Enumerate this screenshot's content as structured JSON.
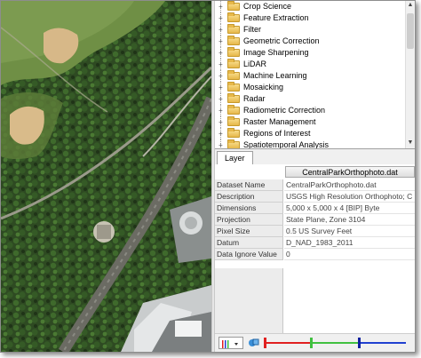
{
  "toolbox": {
    "items": [
      {
        "label": "Crop Science"
      },
      {
        "label": "Feature Extraction"
      },
      {
        "label": "Filter"
      },
      {
        "label": "Geometric Correction"
      },
      {
        "label": "Image Sharpening"
      },
      {
        "label": "LiDAR"
      },
      {
        "label": "Machine Learning"
      },
      {
        "label": "Mosaicking"
      },
      {
        "label": "Radar"
      },
      {
        "label": "Radiometric Correction"
      },
      {
        "label": "Raster Management"
      },
      {
        "label": "Regions of Interest"
      },
      {
        "label": "Spatiotemporal Analysis"
      }
    ],
    "expander": "+"
  },
  "layer_panel": {
    "tab_label": "Layer",
    "file_name": "CentralParkOrthophoto.dat",
    "properties": [
      {
        "key": "Dataset Name",
        "value": "CentralParkOrthophoto.dat"
      },
      {
        "key": "Description",
        "value": "USGS High Resolution Orthophoto; C"
      },
      {
        "key": "Dimensions",
        "value": "5,000 x 5,000 x 4 [BIP] Byte"
      },
      {
        "key": "Projection",
        "value": "State Plane, Zone 3104"
      },
      {
        "key": "Pixel Size",
        "value": "0.5 US Survey Feet"
      },
      {
        "key": "Datum",
        "value": "D_NAD_1983_2011"
      },
      {
        "key": "Data Ignore Value",
        "value": "0"
      }
    ]
  },
  "colors": {
    "stretch_red": "#e02020",
    "stretch_green": "#40c040",
    "stretch_blue": "#2040d0"
  }
}
